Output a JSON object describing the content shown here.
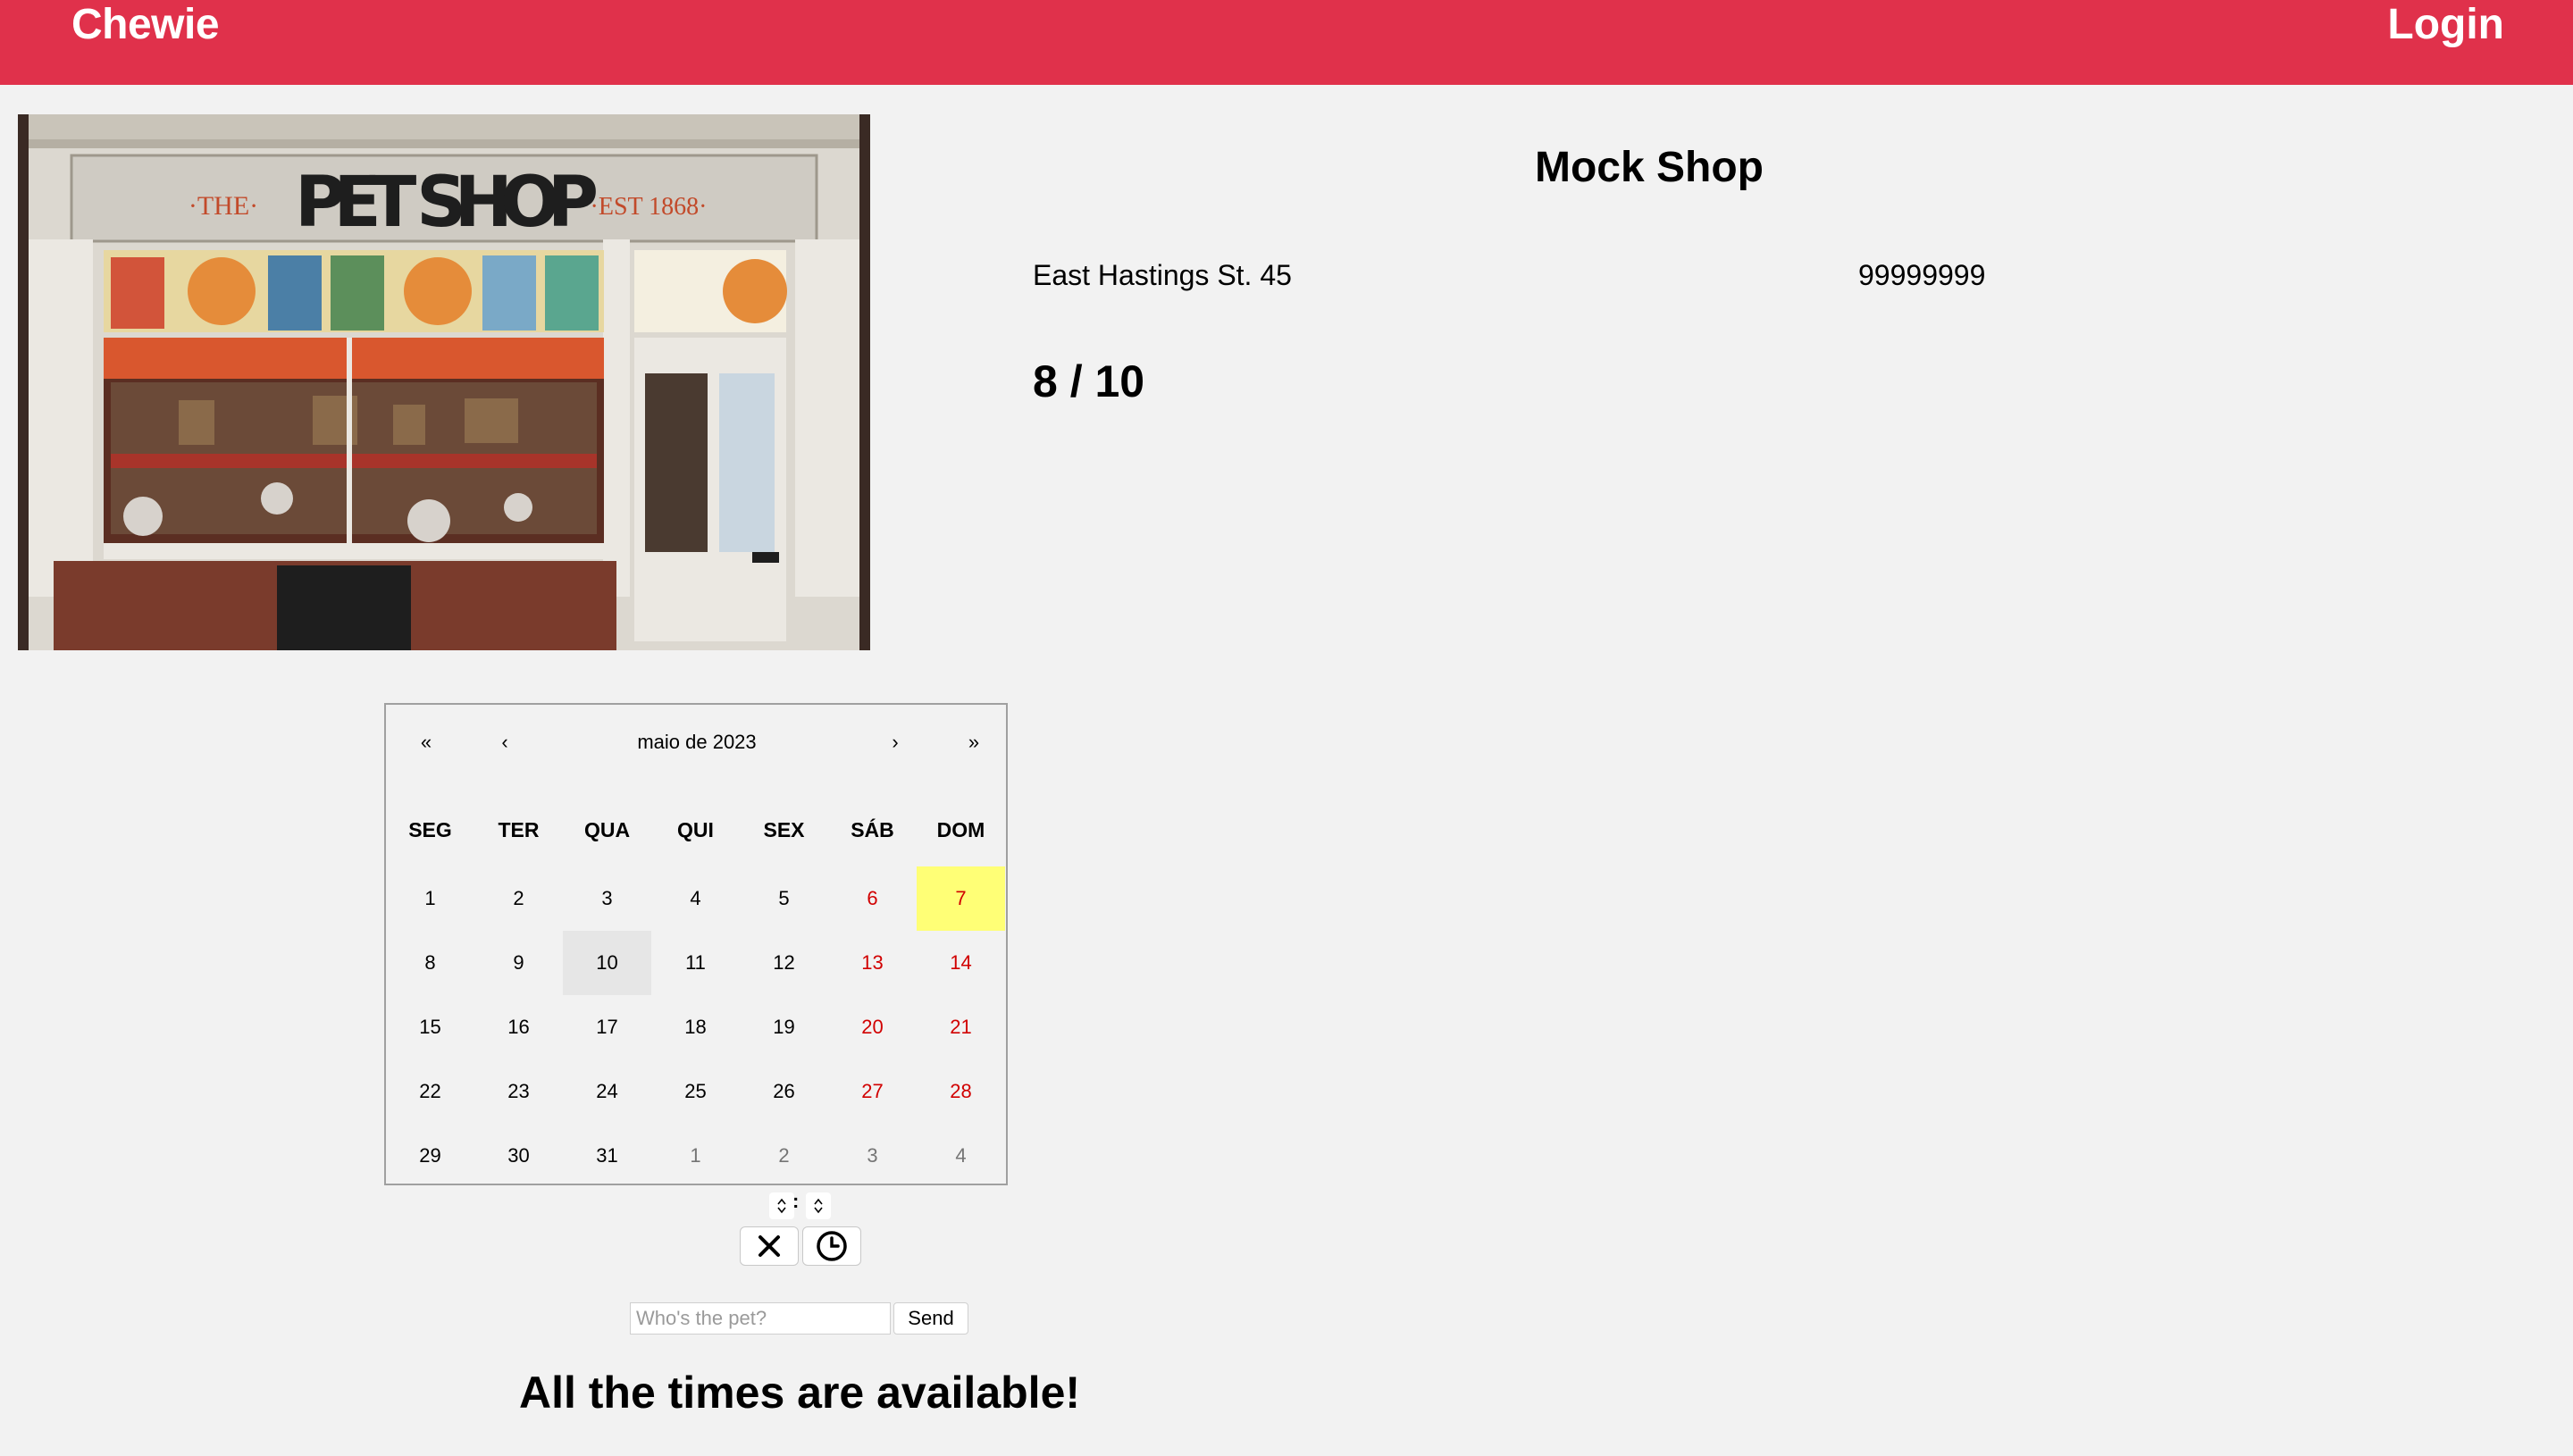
{
  "nav": {
    "brand": "Chewie",
    "login": "Login"
  },
  "shop": {
    "image_sign_left": "·THE·",
    "image_sign_main": "PET SHOP",
    "image_sign_right": "·EST 1868·",
    "name": "Mock Shop",
    "address": "East Hastings St. 45",
    "phone": "99999999",
    "rating": "8 / 10"
  },
  "calendar": {
    "prev_year": "«",
    "prev_month": "‹",
    "title": "maio de 2023",
    "next_month": "›",
    "next_year": "»",
    "weekdays": [
      "SEG",
      "TER",
      "QUA",
      "QUI",
      "SEX",
      "SÁB",
      "DOM"
    ],
    "weeks": [
      [
        "1",
        "2",
        "3",
        "4",
        "5",
        "6",
        "7"
      ],
      [
        "8",
        "9",
        "10",
        "11",
        "12",
        "13",
        "14"
      ],
      [
        "15",
        "16",
        "17",
        "18",
        "19",
        "20",
        "21"
      ],
      [
        "22",
        "23",
        "24",
        "25",
        "26",
        "27",
        "28"
      ],
      [
        "29",
        "30",
        "31",
        "1",
        "2",
        "3",
        "4"
      ]
    ],
    "today": "7",
    "selected": "10",
    "colors": {
      "weekend": "#d10000",
      "today_bg": "#ffff76",
      "selected_bg": "#e6e6e6",
      "other_month": "#757575"
    }
  },
  "time_picker": {
    "separator": ":",
    "clear_icon": "close-icon",
    "clock_icon": "clock-icon"
  },
  "booking": {
    "pet_placeholder": "Who's the pet?",
    "send": "Send"
  },
  "availability": "All the times are available!",
  "colors": {
    "header": "#e0314b",
    "background": "#f2f2f2"
  }
}
